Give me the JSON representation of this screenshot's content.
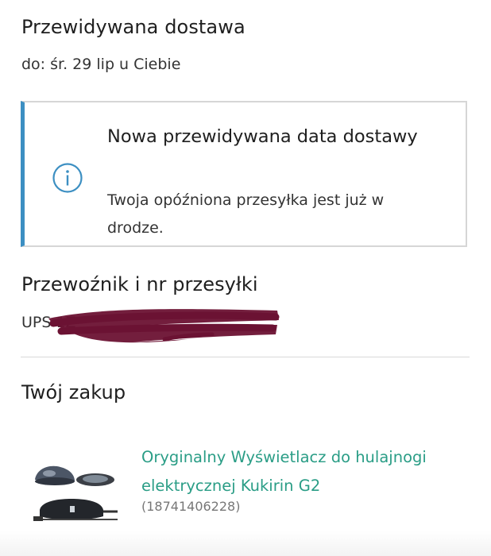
{
  "delivery": {
    "title": "Przewidywana dostawa",
    "date_text": "do: śr. 29 lip u Ciebie"
  },
  "notice": {
    "icon": "info-icon",
    "title": "Nowa przewidywana data dostawy",
    "body": "Twoja opóźniona przesyłka jest już w drodze.",
    "accent_color": "#3c8fc2"
  },
  "carrier": {
    "title": "Przewoźnik i nr przesyłki",
    "value": "UPS 1Z",
    "redaction_color": "#6b1233"
  },
  "purchase": {
    "title": "Twój zakup",
    "product_name": "Oryginalny Wyświetlacz do hulajnogi elektrycznej Kukirin G2",
    "product_id": "(18741406228)",
    "link_color": "#2a9d86"
  }
}
